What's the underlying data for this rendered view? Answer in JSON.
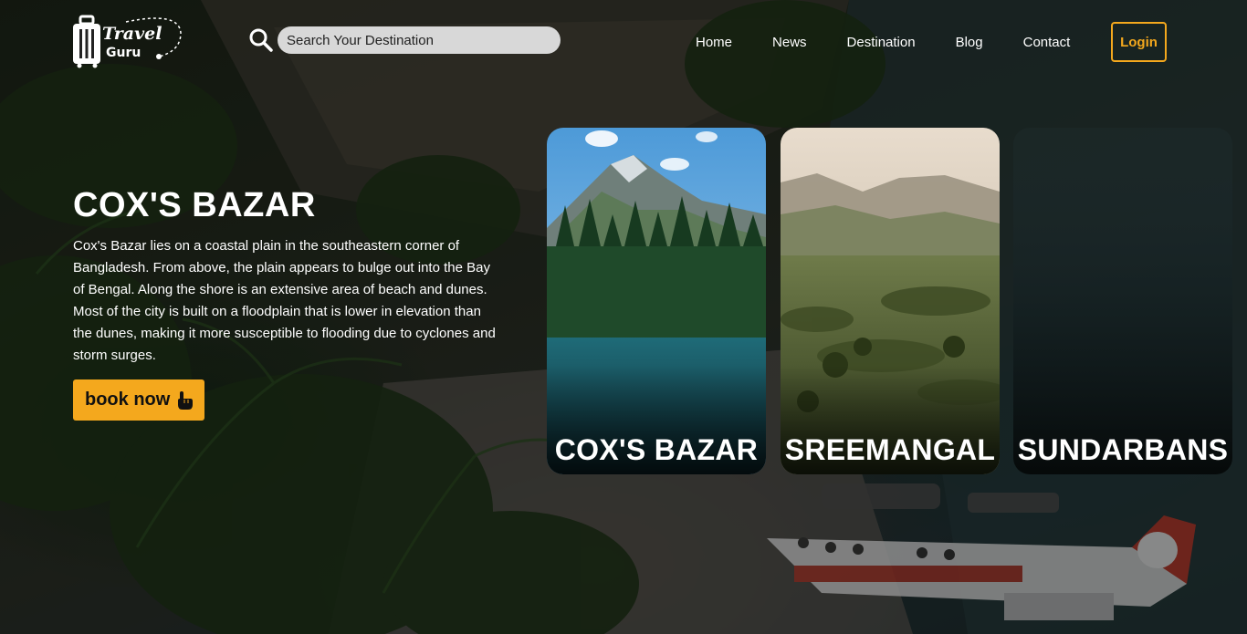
{
  "brand": {
    "line1": "Travel",
    "line2": "Guru",
    "icon": "suitcase-icon"
  },
  "search": {
    "placeholder": "Search Your Destination",
    "value": "",
    "icon": "search-icon"
  },
  "nav": {
    "items": [
      {
        "label": "Home"
      },
      {
        "label": "News"
      },
      {
        "label": "Destination"
      },
      {
        "label": "Blog"
      },
      {
        "label": "Contact"
      }
    ],
    "login_label": "Login"
  },
  "hero": {
    "title": "COX'S BAZAR",
    "description": "Cox's Bazar lies on a coastal plain in the southeastern corner of Bangladesh. From above, the plain appears to bulge out into the Bay of Bengal. Along the shore is an extensive area of beach and dunes. Most of the city is built on a floodplain that is lower in elevation than the dunes, making it more susceptible to flooding due to cyclones and storm surges.",
    "cta_label": "book now",
    "cta_icon": "pointing-hand-icon"
  },
  "destinations": [
    {
      "label": "COX'S BAZAR"
    },
    {
      "label": "SREEMANGAL"
    },
    {
      "label": "SUNDARBANS"
    }
  ],
  "colors": {
    "accent": "#f4a81d",
    "search_bg": "#d8d8d8",
    "text": "#ffffff"
  }
}
